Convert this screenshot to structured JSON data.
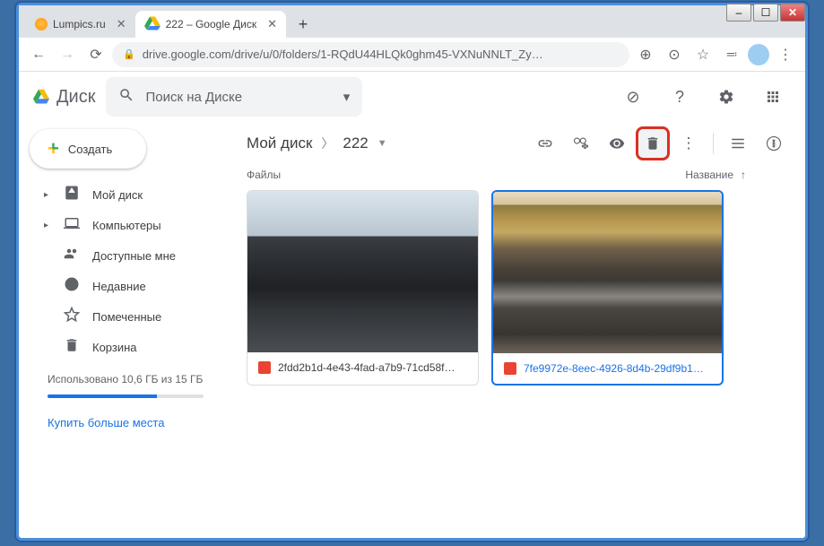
{
  "window": {
    "title": "222 – Google Диск"
  },
  "tabs": [
    {
      "title": "Lumpics.ru",
      "active": false
    },
    {
      "title": "222 – Google Диск",
      "active": true
    }
  ],
  "url": "drive.google.com/drive/u/0/folders/1-RQdU44HLQk0ghm45-VXNuNNLT_Zy…",
  "app_name": "Диск",
  "search_placeholder": "Поиск на Диске",
  "create_label": "Создать",
  "sidebar": [
    {
      "icon": "my-drive",
      "label": "Мой диск",
      "chevron": true
    },
    {
      "icon": "computers",
      "label": "Компьютеры",
      "chevron": true
    },
    {
      "icon": "shared",
      "label": "Доступные мне",
      "chevron": false
    },
    {
      "icon": "recent",
      "label": "Недавние",
      "chevron": false
    },
    {
      "icon": "starred",
      "label": "Помеченные",
      "chevron": false
    },
    {
      "icon": "trash",
      "label": "Корзина",
      "chevron": false
    }
  ],
  "storage_text": "Использовано 10,6 ГБ из 15 ГБ",
  "buy_more": "Купить больше места",
  "breadcrumb": [
    {
      "label": "Мой диск"
    },
    {
      "label": "222"
    }
  ],
  "sort": {
    "files_label": "Файлы",
    "name_label": "Название"
  },
  "files": [
    {
      "name": "2fdd2b1d-4e43-4fad-a7b9-71cd58f…",
      "selected": false
    },
    {
      "name": "7fe9972e-8eec-4926-8d4b-29df9b1…",
      "selected": true
    }
  ]
}
